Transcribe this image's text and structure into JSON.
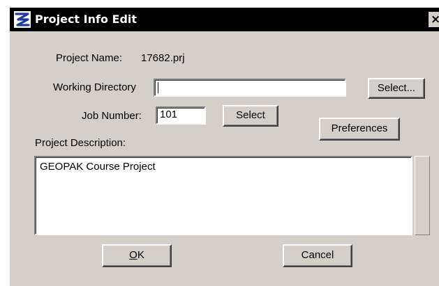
{
  "window": {
    "title": "Project Info Edit",
    "close_glyph": "×",
    "app_icon": "geopak-logo-icon"
  },
  "form": {
    "project_name_label": "Project Name:",
    "project_name_value": "17682.prj",
    "working_directory_label": "Working Directory",
    "working_directory_value": "",
    "select_dir_button": "Select...",
    "job_number_label": "Job Number:",
    "job_number_value": "101",
    "select_job_button": "Select",
    "preferences_button": "Preferences",
    "project_description_label": "Project Description:",
    "project_description_value": "GEOPAK Course Project"
  },
  "buttons": {
    "ok_mnemonic": "O",
    "ok_rest": "K",
    "cancel": "Cancel"
  },
  "colors": {
    "title_bar": "#000000",
    "dialog_face": "#d4d0c8",
    "field_bg": "#ffffff",
    "icon_blue": "#1e3ca0"
  }
}
